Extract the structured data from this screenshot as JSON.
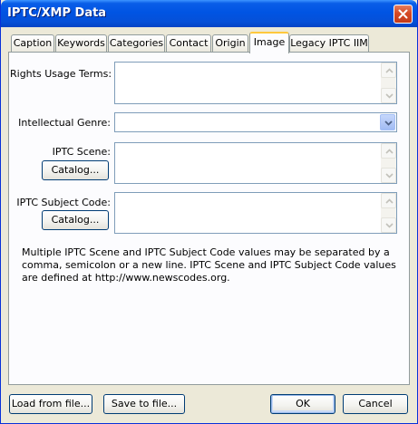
{
  "window": {
    "title": "IPTC/XMP Data"
  },
  "tabs": [
    {
      "label": "Caption",
      "active": false
    },
    {
      "label": "Keywords",
      "active": false
    },
    {
      "label": "Categories",
      "active": false
    },
    {
      "label": "Contact",
      "active": false
    },
    {
      "label": "Origin",
      "active": false
    },
    {
      "label": "Image",
      "active": true
    },
    {
      "label": "Legacy IPTC IIM",
      "active": false
    }
  ],
  "form": {
    "rights_usage_terms_label": "Rights Usage Terms:",
    "rights_usage_terms_value": "",
    "intellectual_genre_label": "Intellectual Genre:",
    "intellectual_genre_value": "",
    "iptc_scene_label": "IPTC Scene:",
    "iptc_scene_value": "",
    "iptc_scene_catalog_button": "Catalog...",
    "iptc_subject_code_label": "IPTC Subject Code:",
    "iptc_subject_code_value": "",
    "iptc_subject_code_catalog_button": "Catalog...",
    "info_text": "Multiple IPTC Scene and IPTC Subject Code values may be separated by a comma, semicolon or a new line. IPTC Scene and IPTC Subject Code values are defined at http://www.newscodes.org."
  },
  "footer": {
    "load_button": "Load from file...",
    "save_button": "Save to file...",
    "ok_button": "OK",
    "cancel_button": "Cancel"
  },
  "icons": {
    "close": "close-icon",
    "scroll_up": "chevron-up-icon",
    "scroll_down": "chevron-down-icon",
    "dropdown": "chevron-down-icon"
  },
  "colors": {
    "titlebar": "#0054e3",
    "active_tab_highlight": "#ffc83c",
    "dialog_background": "#ece9d8",
    "field_border": "#7f9db9"
  }
}
